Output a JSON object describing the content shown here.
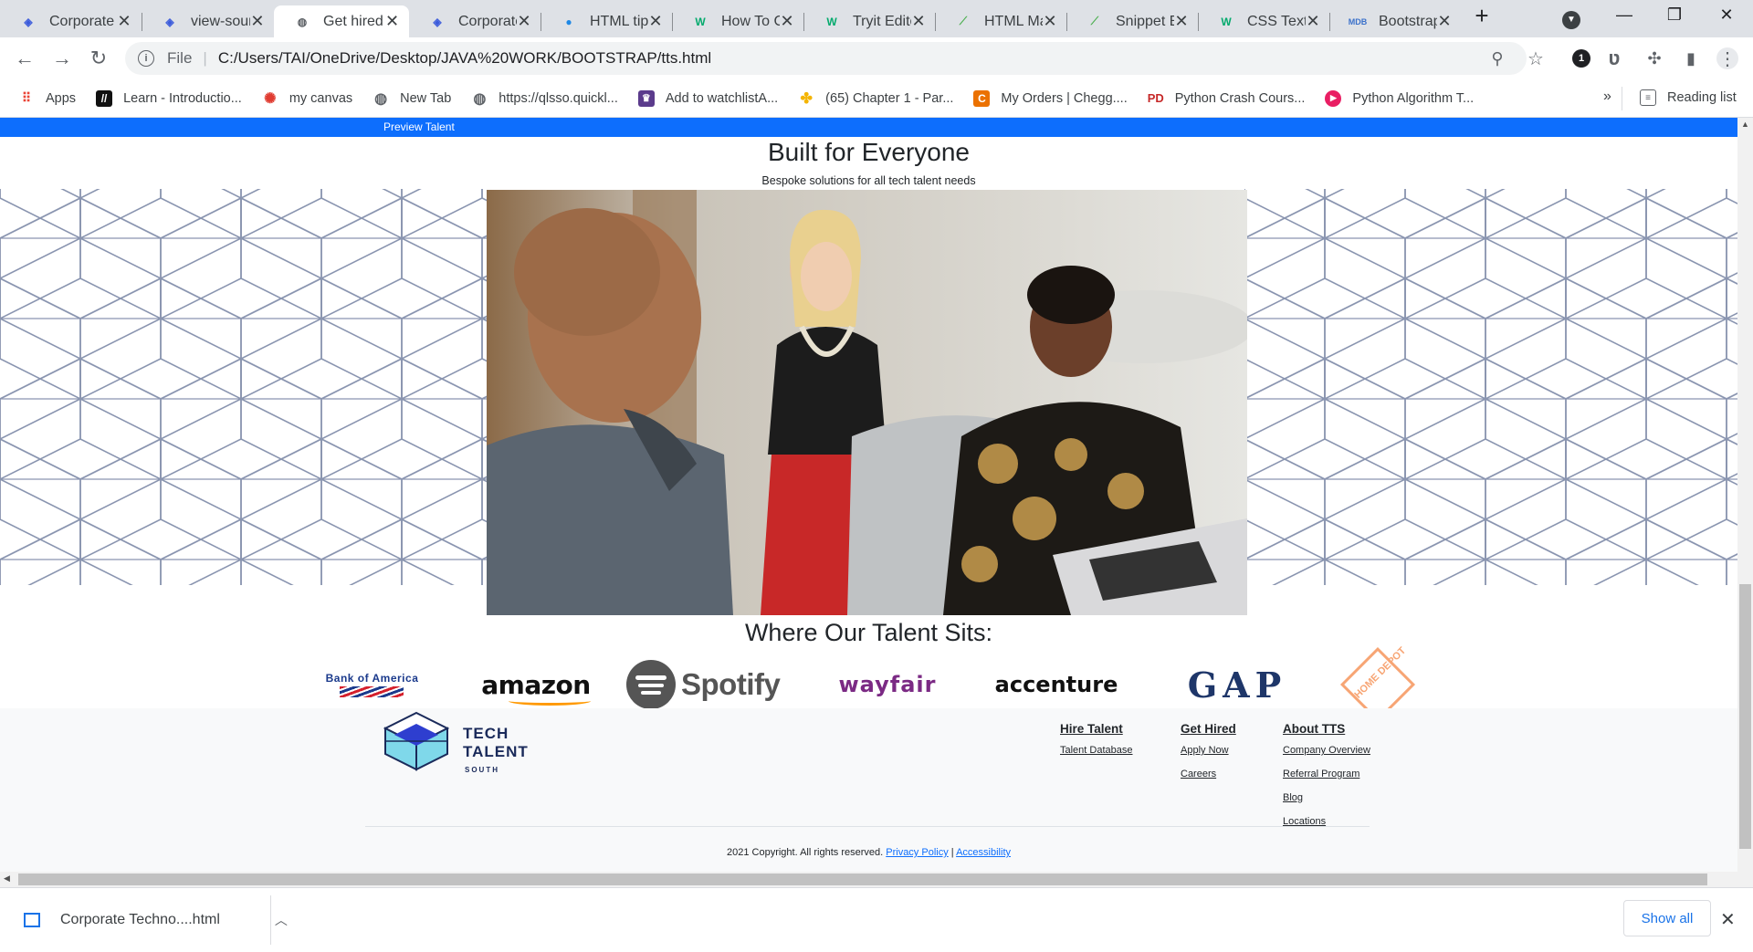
{
  "browser": {
    "tabs": [
      {
        "title": "Corporate",
        "icon": "tts-favicon",
        "active": false
      },
      {
        "title": "view-sour",
        "icon": "tts-favicon",
        "active": false
      },
      {
        "title": "Get hired",
        "icon": "globe-icon",
        "active": true
      },
      {
        "title": "Corporate",
        "icon": "tts-favicon",
        "active": false
      },
      {
        "title": "HTML tip",
        "icon": "earth-icon",
        "active": false
      },
      {
        "title": "How To C",
        "icon": "w3schools-icon",
        "active": false
      },
      {
        "title": "Tryit Edito",
        "icon": "w3schools-icon",
        "active": false
      },
      {
        "title": "HTML Ma",
        "icon": "chart-icon",
        "active": false
      },
      {
        "title": "Snippet E",
        "icon": "chart-icon",
        "active": false
      },
      {
        "title": "CSS Text",
        "icon": "w3schools-icon",
        "active": false
      },
      {
        "title": "Bootstrap",
        "icon": "mdb-icon",
        "active": false
      }
    ],
    "address": {
      "scheme_label": "File",
      "url": "C:/Users/TAI/OneDrive/Desktop/JAVA%20WORK/BOOTSTRAP/tts.html"
    },
    "extension_badge": "1",
    "bookmarks": [
      {
        "label": "Apps",
        "icon": "apps-grid-icon"
      },
      {
        "label": "Learn - Introductio...",
        "icon": "learn-icon"
      },
      {
        "label": "my canvas",
        "icon": "canvas-icon"
      },
      {
        "label": "New Tab",
        "icon": "globe-icon"
      },
      {
        "label": "https://qlsso.quickl...",
        "icon": "globe-icon"
      },
      {
        "label": "Add to watchlistA...",
        "icon": "crown-icon"
      },
      {
        "label": "(65) Chapter 1 - Par...",
        "icon": "pinwheel-icon"
      },
      {
        "label": "My Orders | Chegg....",
        "icon": "chegg-icon"
      },
      {
        "label": "Python Crash Cours...",
        "icon": "pd-icon"
      },
      {
        "label": "Python Algorithm T...",
        "icon": "play-icon"
      }
    ],
    "more_bookmarks": "»",
    "reading_list": "Reading list"
  },
  "page": {
    "nav_link": "Preview Talent",
    "heading": "Built for Everyone",
    "subheading": "Bespoke solutions for all tech talent needs",
    "talent_heading": "Where Our Talent Sits:",
    "companies": [
      "Bank of America",
      "amazon",
      "Spotify",
      "wayfair",
      "accenture",
      "GAP",
      "HOME DEPOT"
    ],
    "footer": {
      "brand_line1": "TECH",
      "brand_line2": "TALENT",
      "brand_line3": "SOUTH",
      "columns": [
        {
          "heading": "Hire Talent",
          "links": [
            "Talent Database"
          ]
        },
        {
          "heading": "Get Hired",
          "links": [
            "Apply Now",
            "Careers"
          ]
        },
        {
          "heading": "About TTS",
          "links": [
            "Company Overview",
            "Referral Program",
            "Blog",
            "Locations"
          ]
        }
      ],
      "copyright": "2021 Copyright. All rights reserved.",
      "privacy": "Privacy Policy",
      "separator": "|",
      "accessibility": "Accessibility"
    },
    "cube_colors": {
      "purple": "#8f8ff5",
      "cyan": "#7fe3f5",
      "orange": "#ffb56b",
      "yellow": "#ffe58a",
      "teal": "#7fdcd2",
      "mint": "#8fffd6",
      "red": "#f08080",
      "pink": "#ffc8d2",
      "green": "#98e67a",
      "lime": "#e8ff9a",
      "magenta": "#cc88dd",
      "violet": "#ffb8f5"
    }
  },
  "downloads": {
    "file": "Corporate Techno....html",
    "show_all": "Show all"
  }
}
